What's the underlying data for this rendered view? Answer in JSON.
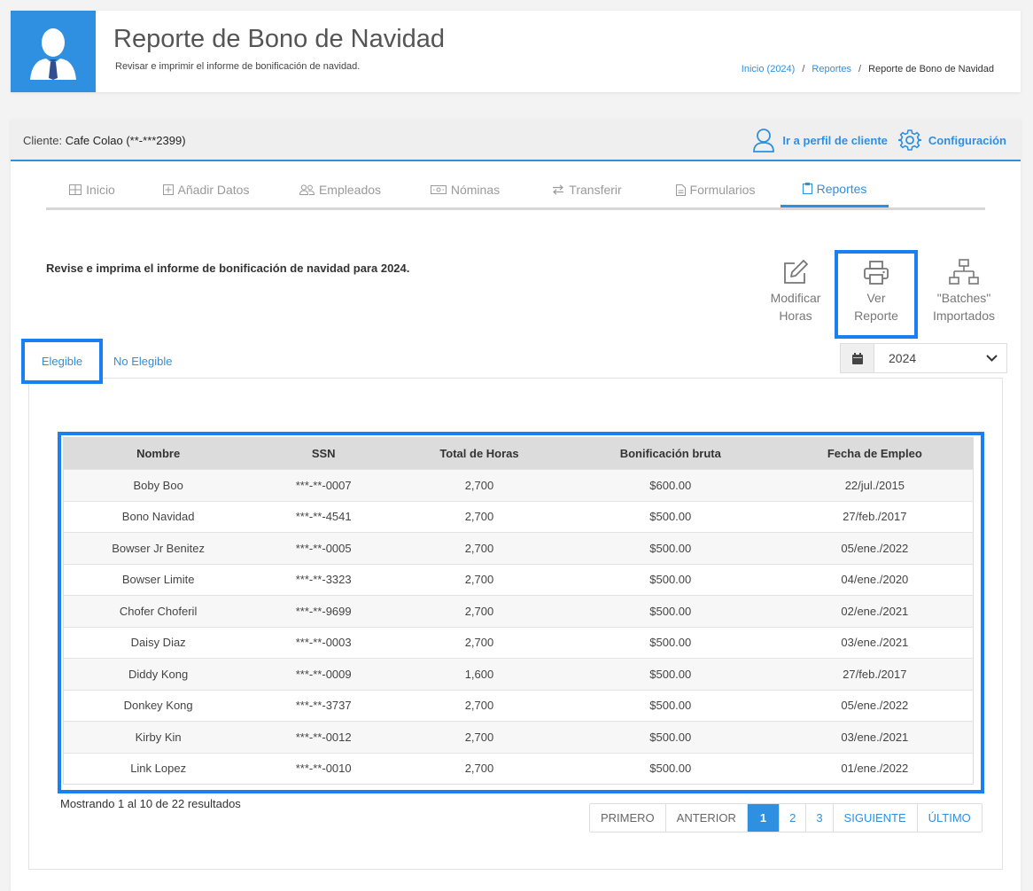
{
  "header": {
    "title": "Reporte de Bono de Navidad",
    "subtitle": "Revisar e imprimir el informe de bonificación de navidad.",
    "breadcrumb": [
      {
        "label": "Inicio (2024)"
      },
      {
        "label": "Reportes"
      },
      {
        "label": "Reporte de Bono de Navidad"
      }
    ],
    "icon": "user-tie-icon",
    "accent_color": "#2f8fe0"
  },
  "client": {
    "label": "Cliente:",
    "name": "Cafe Colao (**-***2399)",
    "profile_link": "Ir a perfil de cliente",
    "settings_link": "Configuración"
  },
  "tabs": [
    {
      "label": "Inicio",
      "icon": "grid-icon"
    },
    {
      "label": "Añadir Datos",
      "icon": "plus-square-icon"
    },
    {
      "label": "Empleados",
      "icon": "users-icon"
    },
    {
      "label": "Nóminas",
      "icon": "money-icon"
    },
    {
      "label": "Transferir",
      "icon": "transfer-icon"
    },
    {
      "label": "Formularios",
      "icon": "file-icon"
    },
    {
      "label": "Reportes",
      "icon": "clipboard-icon",
      "active": true
    }
  ],
  "intro": "Revise e imprima el informe de bonificación de navidad para 2024.",
  "actions": {
    "modify": {
      "line1": "Modificar",
      "line2": "Horas"
    },
    "view": {
      "line1": "Ver",
      "line2": "Reporte"
    },
    "batches": {
      "line1": "\"Batches\"",
      "line2": "Importados"
    }
  },
  "subtabs": {
    "eligible": "Elegible",
    "not_eligible": "No Elegible"
  },
  "year_select": {
    "value": "2024"
  },
  "table": {
    "headers": [
      "Nombre",
      "SSN",
      "Total de Horas",
      "Bonificación bruta",
      "Fecha de Empleo"
    ],
    "rows": [
      [
        "Boby Boo",
        "***-**-0007",
        "2,700",
        "$600.00",
        "22/jul./2015"
      ],
      [
        "Bono Navidad",
        "***-**-4541",
        "2,700",
        "$500.00",
        "27/feb./2017"
      ],
      [
        "Bowser Jr Benitez",
        "***-**-0005",
        "2,700",
        "$500.00",
        "05/ene./2022"
      ],
      [
        "Bowser Limite",
        "***-**-3323",
        "2,700",
        "$500.00",
        "04/ene./2020"
      ],
      [
        "Chofer Choferil",
        "***-**-9699",
        "2,700",
        "$500.00",
        "02/ene./2021"
      ],
      [
        "Daisy Diaz",
        "***-**-0003",
        "2,700",
        "$500.00",
        "03/ene./2021"
      ],
      [
        "Diddy Kong",
        "***-**-0009",
        "1,600",
        "$500.00",
        "27/feb./2017"
      ],
      [
        "Donkey Kong",
        "***-**-3737",
        "2,700",
        "$500.00",
        "05/ene./2022"
      ],
      [
        "Kirby Kin",
        "***-**-0012",
        "2,700",
        "$500.00",
        "03/ene./2021"
      ],
      [
        "Link Lopez",
        "***-**-0010",
        "2,700",
        "$500.00",
        "01/ene./2022"
      ]
    ]
  },
  "results_info": "Mostrando 1 al 10 de 22 resultados",
  "pagination": {
    "first": "PRIMERO",
    "prev": "ANTERIOR",
    "pages": [
      "1",
      "2",
      "3"
    ],
    "current": "1",
    "next": "SIGUIENTE",
    "last": "ÚLTIMO"
  }
}
